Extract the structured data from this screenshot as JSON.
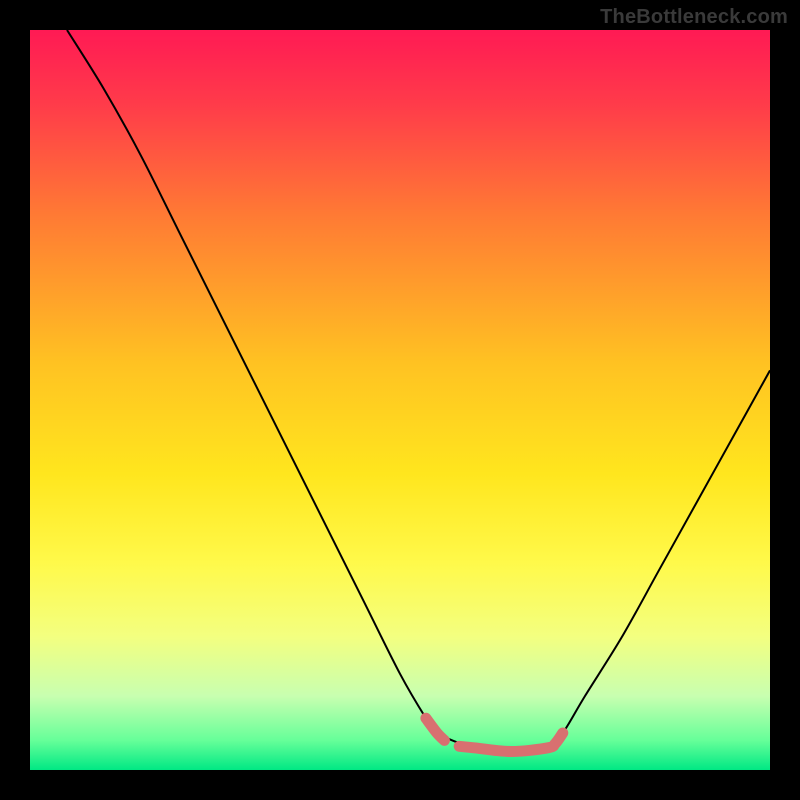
{
  "watermark": "TheBottleneck.com",
  "chart_data": {
    "type": "line",
    "title": "",
    "xlabel": "",
    "ylabel": "",
    "xlim": [
      0,
      100
    ],
    "ylim": [
      0,
      100
    ],
    "grid": false,
    "legend": false,
    "curve": {
      "name": "bottleneck-curve",
      "color": "#000000",
      "x": [
        5,
        10,
        15,
        20,
        25,
        30,
        35,
        40,
        45,
        50,
        53.5,
        55,
        60,
        65,
        70,
        72,
        75,
        80,
        85,
        90,
        95,
        100
      ],
      "y": [
        100,
        92,
        83,
        73,
        63,
        53,
        43,
        33,
        23,
        13,
        7,
        5,
        3,
        2.5,
        3,
        5,
        10,
        18,
        27,
        36,
        45,
        54
      ]
    },
    "highlight": {
      "name": "optimal-range",
      "color": "#d87070",
      "segments": [
        {
          "x": [
            53.5,
            55,
            56
          ],
          "y": [
            7,
            5,
            4
          ]
        },
        {
          "x": [
            58,
            60,
            65,
            70,
            71,
            72
          ],
          "y": [
            3.2,
            3,
            2.5,
            3,
            3.6,
            5
          ]
        }
      ]
    },
    "background_gradient": {
      "stops": [
        {
          "pos": 0.0,
          "color": "#ff1a54"
        },
        {
          "pos": 0.1,
          "color": "#ff3b4a"
        },
        {
          "pos": 0.25,
          "color": "#ff7a34"
        },
        {
          "pos": 0.45,
          "color": "#ffc222"
        },
        {
          "pos": 0.6,
          "color": "#ffe61e"
        },
        {
          "pos": 0.72,
          "color": "#fff94a"
        },
        {
          "pos": 0.82,
          "color": "#f3ff80"
        },
        {
          "pos": 0.9,
          "color": "#c8ffb0"
        },
        {
          "pos": 0.96,
          "color": "#66ff99"
        },
        {
          "pos": 1.0,
          "color": "#00e884"
        }
      ]
    }
  }
}
